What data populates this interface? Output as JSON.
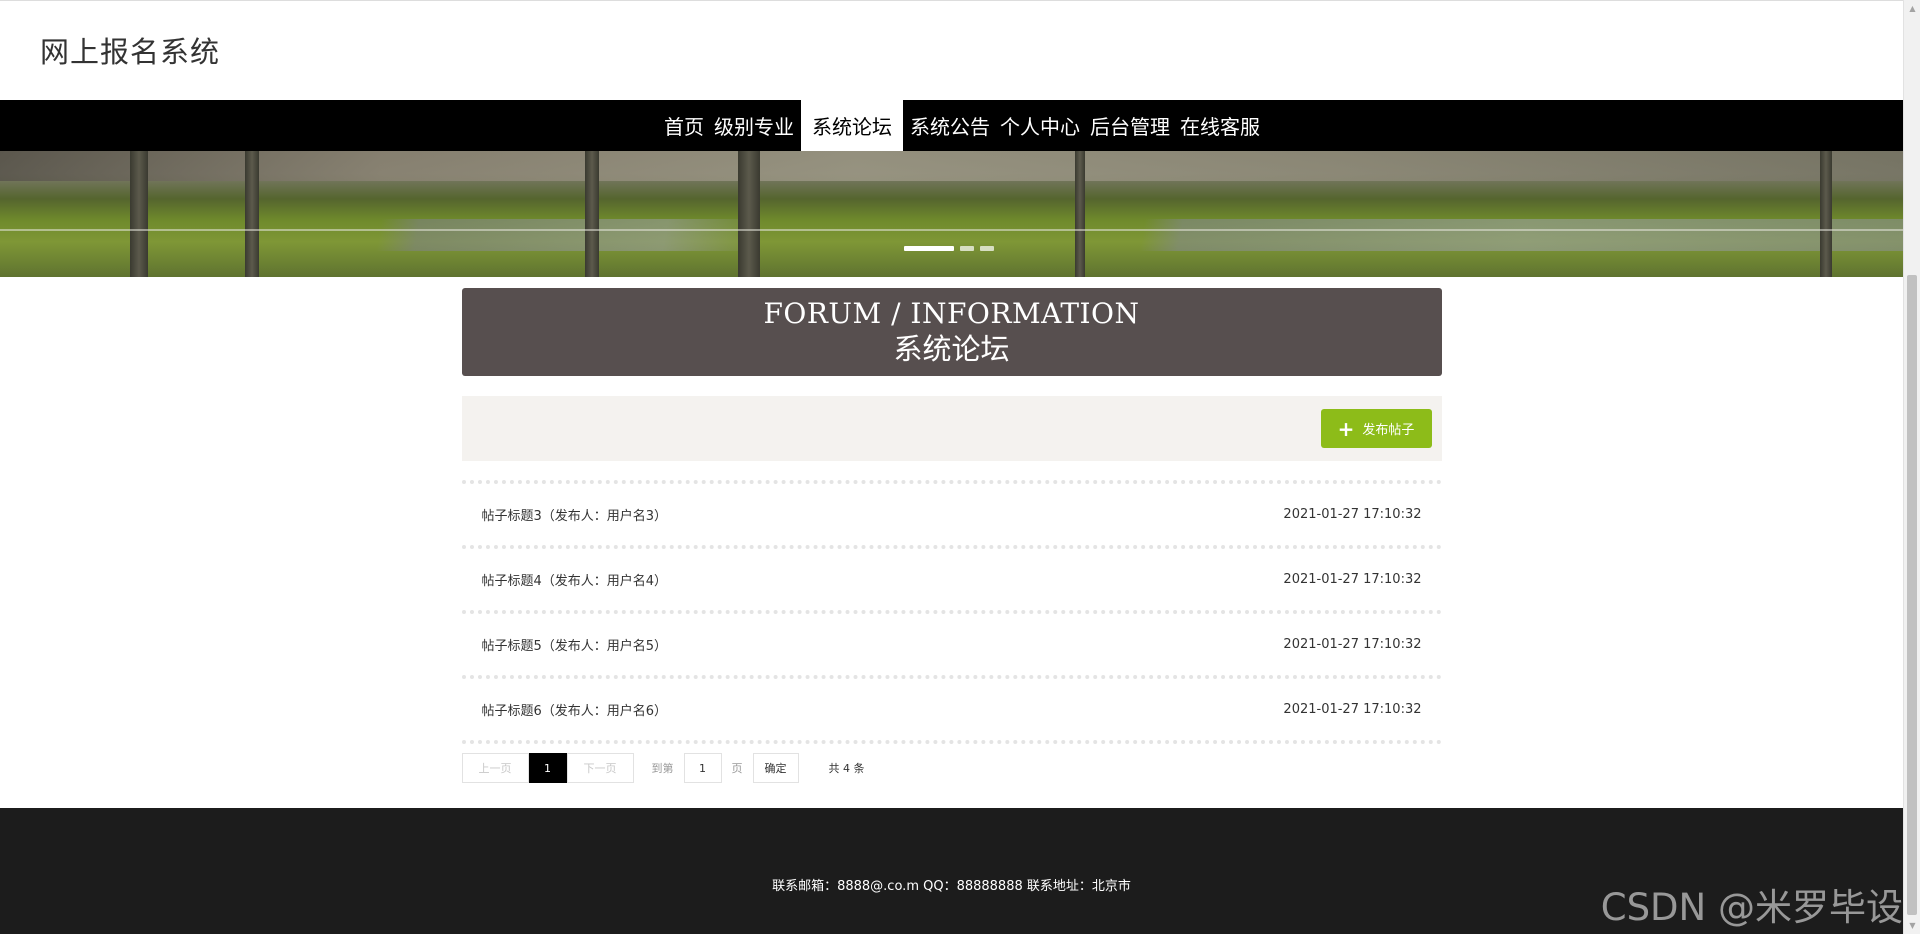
{
  "header": {
    "site_title": "网上报名系统"
  },
  "nav": {
    "items": [
      {
        "label": "首页"
      },
      {
        "label": "级别专业"
      },
      {
        "label": "系统论坛"
      },
      {
        "label": "系统公告"
      },
      {
        "label": "个人中心"
      },
      {
        "label": "后台管理"
      },
      {
        "label": "在线客服"
      }
    ],
    "active_index": 2
  },
  "banner": {
    "slides": 3,
    "active_slide": 1
  },
  "forum": {
    "title_en": "FORUM / INFORMATION",
    "title_cn": "系统论坛",
    "post_button_label": "发布帖子",
    "post_button_icon": "plus-icon",
    "posts": [
      {
        "title": "帖子标题3（发布人：用户名3）",
        "time": "2021-01-27 17:10:32"
      },
      {
        "title": "帖子标题4（发布人：用户名4）",
        "time": "2021-01-27 17:10:32"
      },
      {
        "title": "帖子标题5（发布人：用户名5）",
        "time": "2021-01-27 17:10:32"
      },
      {
        "title": "帖子标题6（发布人：用户名6）",
        "time": "2021-01-27 17:10:32"
      }
    ]
  },
  "pager": {
    "prev_label": "上一页",
    "current": "1",
    "next_label": "下一页",
    "goto_label": "到第",
    "goto_value": "1",
    "page_label": "页",
    "confirm_label": "确定",
    "total_label": "共 4 条"
  },
  "footer": {
    "text": "联系邮箱：8888@.co.m QQ：88888888 联系地址：北京市"
  },
  "watermark": "CSDN @米罗毕设",
  "colors": {
    "accent_green": "#8dbc19",
    "nav_bg": "#000000",
    "title_bg": "#574f4f",
    "footer_bg": "#1c1c1c"
  }
}
